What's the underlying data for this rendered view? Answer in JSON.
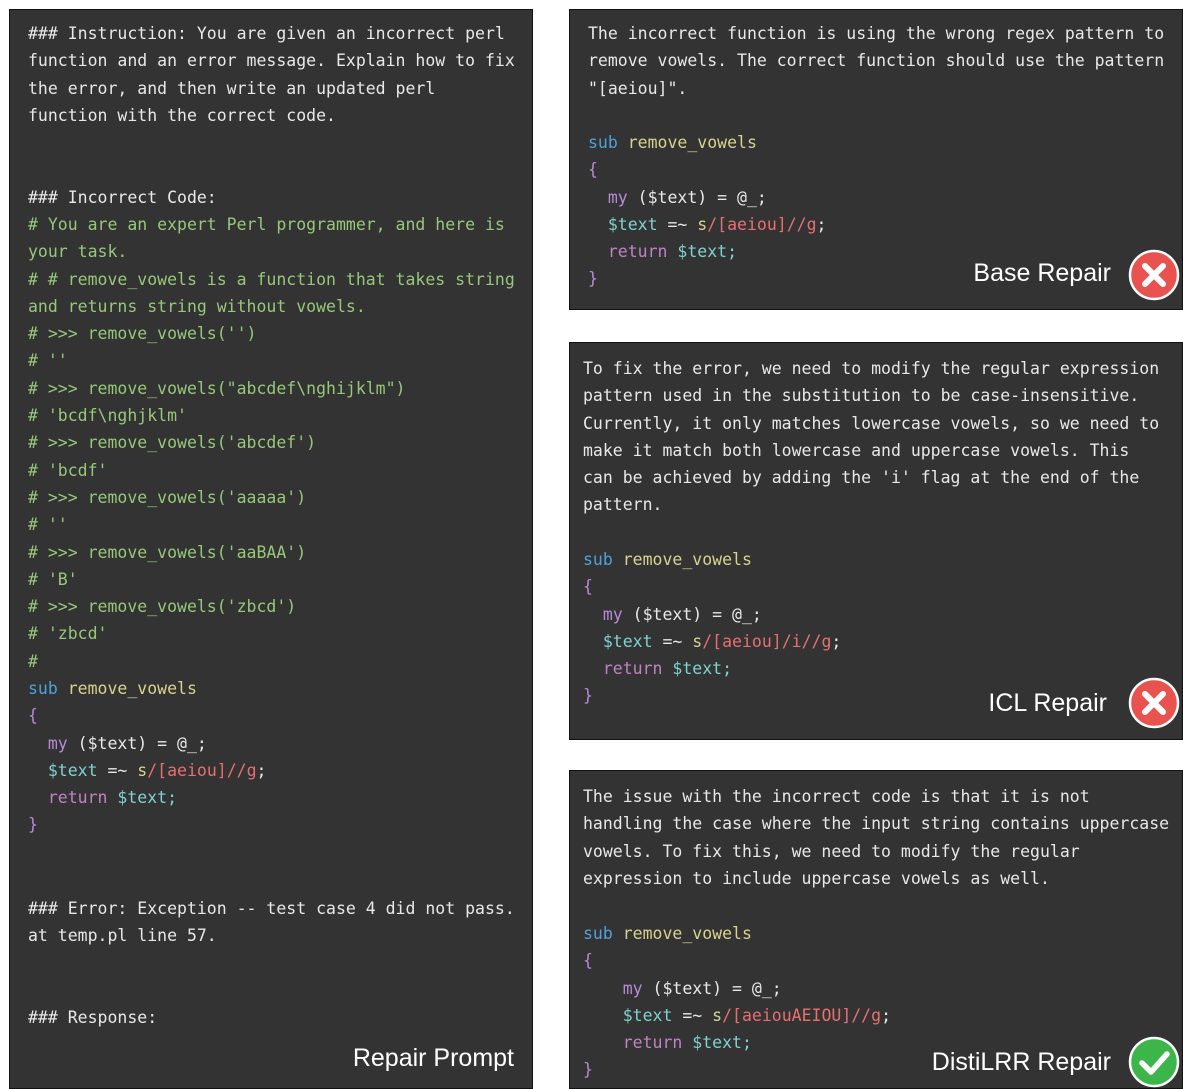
{
  "left": {
    "instruction": [
      "### Instruction: You are given an incorrect perl",
      "function and an error message. Explain how to fix",
      "the error, and then write an updated perl",
      "function with the correct code."
    ],
    "incorrect_header": "### Incorrect Code:",
    "comments": [
      "# You are an expert Perl programmer, and here is",
      "your task.",
      "# # remove_vowels is a function that takes string",
      "and returns string without vowels.",
      "# >>> remove_vowels('')",
      "# ''",
      "# >>> remove_vowels(\"abcdef\\nghijklm\")",
      "# 'bcdf\\nghjklm'",
      "# >>> remove_vowels('abcdef')",
      "# 'bcdf'",
      "# >>> remove_vowels('aaaaa')",
      "# ''",
      "# >>> remove_vowels('aaBAA')",
      "# 'B'",
      "# >>> remove_vowels('zbcd')",
      "# 'zbcd'",
      "#"
    ],
    "code": {
      "sub_kw": "sub",
      "fn_name": " remove_vowels",
      "open_brace": "{",
      "my_kw": "my",
      "my_args": " ($text) = @_;",
      "var_text": "$text",
      "bind_op": " =~ ",
      "s_kw": "s",
      "regex": "/[aeiou]//g",
      "semicolon": ";",
      "return_kw": "return",
      "return_val": " $text;",
      "close_brace": "}"
    },
    "error": [
      "### Error: Exception -- test case 4 did not pass.",
      "at temp.pl line 57."
    ],
    "response": "### Response:",
    "label": "Repair Prompt"
  },
  "base": {
    "text": [
      "The incorrect function is using the wrong regex pattern to",
      "remove vowels. The correct function should use the pattern",
      "\"[aeiou]\"."
    ],
    "regex": "/[aeiou]//g",
    "label": "Base Repair",
    "status": "fail",
    "badge_color": "#e8524f"
  },
  "icl": {
    "text": [
      "To fix the error, we need to modify the regular expression",
      "pattern used in the substitution to be case-insensitive.",
      "Currently, it only matches lowercase vowels, so we need to",
      "make it match both lowercase and uppercase vowels. This",
      "can be achieved by adding the 'i' flag at the end of the",
      "pattern."
    ],
    "regex": "/[aeiou]/i//g",
    "label": "ICL Repair",
    "status": "fail",
    "badge_color": "#e8524f"
  },
  "distil": {
    "text": [
      "The issue with the incorrect code is that it is not",
      "handling the case where the input string contains uppercase",
      "vowels. To fix this, we need to modify the regular",
      "expression to include uppercase vowels as well."
    ],
    "regex": "/[aeiouAEIOU]//g",
    "label": "DistiLRR Repair",
    "status": "pass",
    "badge_color": "#3cb54a"
  }
}
